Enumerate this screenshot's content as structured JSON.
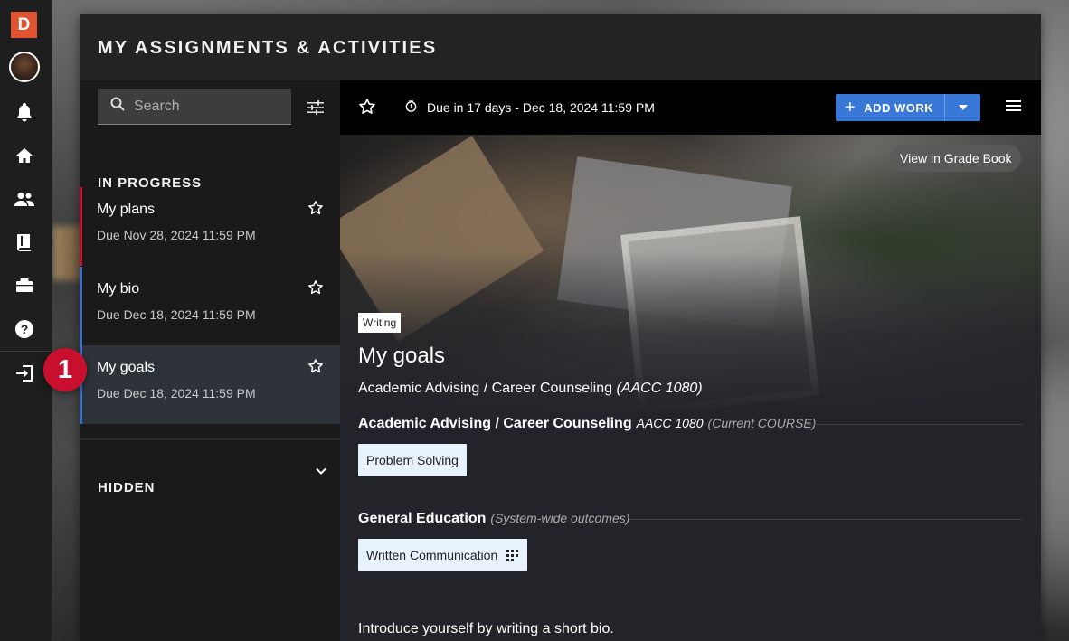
{
  "rail": {
    "logo": "D",
    "icons": [
      "bell-icon",
      "home-icon",
      "people-icon",
      "book-icon",
      "briefcase-icon",
      "help-icon",
      "logout-icon"
    ]
  },
  "callout": {
    "number": "1"
  },
  "modal": {
    "title": "MY ASSIGNMENTS & ACTIVITIES"
  },
  "list": {
    "search_placeholder": "Search",
    "in_progress_label": "IN PROGRESS",
    "hidden_label": "HIDDEN",
    "items": [
      {
        "title": "My plans",
        "due": "Due Nov 28, 2024 11:59 PM"
      },
      {
        "title": "My bio",
        "due": "Due Dec 18, 2024 11:59 PM"
      },
      {
        "title": "My goals",
        "due": "Due Dec 18, 2024 11:59 PM"
      }
    ]
  },
  "detail": {
    "due_text": "Due in 17 days - Dec 18, 2024 11:59 PM",
    "add_work_label": "ADD WORK",
    "grade_book_label": "View in Grade Book",
    "type_tag": "Writing",
    "title": "My goals",
    "course_name": "Academic Advising / Career Counseling",
    "course_code_paren": "(AACC 1080)",
    "groups": [
      {
        "name": "Academic Advising / Career Counseling",
        "code": "AACC 1080",
        "note": "(Current COURSE)",
        "chips": [
          "Problem Solving"
        ]
      },
      {
        "name": "General Education",
        "code": "",
        "note": "(System-wide outcomes)",
        "chips": [
          "Written Communication"
        ]
      }
    ],
    "description": "Introduce yourself by writing a short bio."
  },
  "colors": {
    "accent": "#3a78d8",
    "callout": "#c8102e",
    "logo": "#e2522f",
    "plans_border": "#c8102e",
    "bio_border": "#3b6fc9"
  }
}
